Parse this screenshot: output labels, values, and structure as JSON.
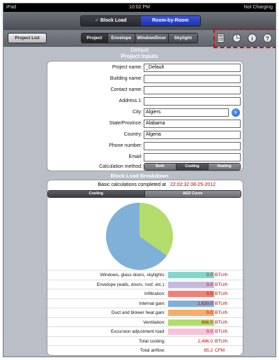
{
  "status": {
    "device": "iPad",
    "time": "10:02 PM",
    "battery": "Not Charging"
  },
  "mode_tabs": [
    "Block Load",
    "Room-by-Room"
  ],
  "toolbar": {
    "project_list": "Project List",
    "tabs": [
      "Project",
      "Envelope",
      "Window/Door",
      "Skylight"
    ],
    "icons": [
      "calculator-icon",
      "pie-chart-icon",
      "info-icon",
      "help-icon"
    ]
  },
  "title": {
    "project": "Default",
    "section": "Project Inputs"
  },
  "fields": [
    {
      "label": "Project name:",
      "value": "_Default"
    },
    {
      "label": "Building name:",
      "value": ""
    },
    {
      "label": "Contact name:",
      "value": ""
    },
    {
      "label": "Address 1:",
      "value": ""
    },
    {
      "label": "City:",
      "value": "Algiers"
    },
    {
      "label": "State/Province:",
      "value": "Alabama"
    },
    {
      "label": "Country:",
      "value": "Algeria"
    },
    {
      "label": "Phone number:",
      "value": ""
    },
    {
      "label": "Email:",
      "value": ""
    }
  ],
  "calc_method": {
    "label": "Calculation method:",
    "options": [
      "Both",
      "Cooling",
      "Heating"
    ],
    "selected": "Cooling"
  },
  "breakdown": {
    "title": "Block Load Breakdown",
    "calc_label": "Basic calculations completed at",
    "calc_time": "22:02:32 08-25-2012",
    "tabs": [
      "Cooling",
      "AED Curve"
    ],
    "rows": [
      {
        "label": "Windows, glass doors, skylights:",
        "value": "0.0",
        "unit": "BTU/h",
        "color": "#7fd8c8"
      },
      {
        "label": "Envelope (walls, doors, roof, etc.):",
        "value": "0.0",
        "unit": "BTU/h",
        "color": "#c5b9dd"
      },
      {
        "label": "Infiltration:",
        "value": "0.0",
        "unit": "BTU/h",
        "color": "#f08078"
      },
      {
        "label": "Internal gain:",
        "value": "1,630.0",
        "unit": "BTU/h",
        "color": "#7fb0d8"
      },
      {
        "label": "Duct and blower heat gain:",
        "value": "0.0",
        "unit": "BTU/h",
        "color": "#f5ad6a"
      },
      {
        "label": "Ventilation:",
        "value": "866.0",
        "unit": "BTU/h",
        "color": "#b4dc6c"
      },
      {
        "label": "Excursion adjustment load:",
        "value": "0.0",
        "unit": "BTU/h",
        "color": "#f7c2da"
      }
    ],
    "totals": [
      {
        "label": "Total cooling:",
        "value": "2,496.0",
        "unit": "BTU/h"
      },
      {
        "label": "Total airflow:",
        "value": "65.2",
        "unit": "CFM"
      }
    ],
    "pie": [
      {
        "name": "Internal gain",
        "value": 1630.0,
        "color": "#7fb0d8"
      },
      {
        "name": "Ventilation",
        "value": 866.0,
        "color": "#b4dc6c"
      }
    ]
  }
}
